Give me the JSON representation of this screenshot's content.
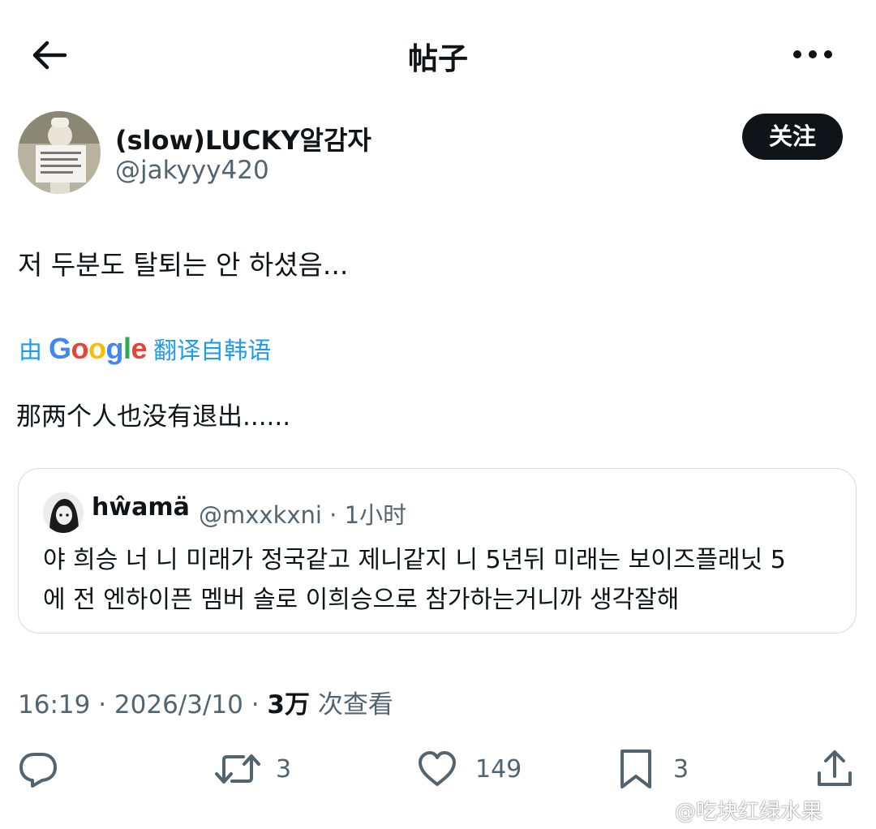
{
  "header": {
    "title": "帖子",
    "back_icon": "arrow-left-icon",
    "more_icon": "ellipsis-icon"
  },
  "author": {
    "display_name": "(slow)LUCKY알감자",
    "handle": "@jakyyy420",
    "follow_label": "关注"
  },
  "post": {
    "text": "저 두분도 탈퇴는 안 하셨음...",
    "translation": {
      "prefix": "由",
      "provider": "Google",
      "suffix": "翻译自韩语",
      "text": "那两个人也没有退出......"
    }
  },
  "quote": {
    "display_name": "hŵamä",
    "handle": "@mxxkxni",
    "time": "1小时",
    "lines": [
      "야 희승 너 니 미래가 정국같고 제니같지 니 5년뒤 미래는 보이즈플래닛 5",
      "에 전 엔하이픈 멤버 솔로 이희승으로 참가하는거니까 생각잘해"
    ]
  },
  "meta": {
    "time": "16:19",
    "date": "2026/3/10",
    "views_count": "3万",
    "views_label": "次查看"
  },
  "actions": {
    "reply": {
      "icon": "reply-icon",
      "count": ""
    },
    "repost": {
      "icon": "repost-icon",
      "count": "3"
    },
    "like": {
      "icon": "heart-icon",
      "count": "149"
    },
    "bookmark": {
      "icon": "bookmark-icon",
      "count": "3"
    },
    "share": {
      "icon": "share-icon",
      "count": ""
    }
  },
  "watermark": "@吃块红绿水果",
  "colors": {
    "text": "#0f1419",
    "secondary": "#536471",
    "link": "#1d9bf0",
    "button": "#0f1419"
  }
}
